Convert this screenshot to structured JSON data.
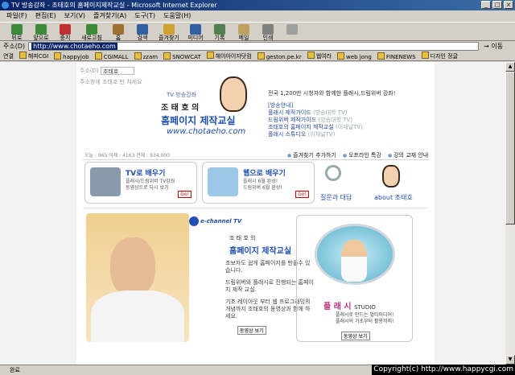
{
  "window": {
    "title": "TV 방송강좌 - 조태호의 홈페이지제작교실 - Microsoft Internet Explorer"
  },
  "menu": [
    "파일(F)",
    "편집(E)",
    "보기(V)",
    "즐겨찾기(A)",
    "도구(T)",
    "도움말(H)"
  ],
  "toolbar": [
    {
      "label": "뒤로",
      "icon": "back-icon",
      "color": "#3a8a3a"
    },
    {
      "label": "앞으로",
      "icon": "forward-icon",
      "color": "#3a8a3a"
    },
    {
      "label": "중지",
      "icon": "stop-icon",
      "color": "#c03030"
    },
    {
      "label": "새로고침",
      "icon": "refresh-icon",
      "color": "#3a8a3a"
    },
    {
      "label": "홈",
      "icon": "home-icon",
      "color": "#a07030"
    },
    {
      "label": "검색",
      "icon": "search-icon",
      "color": "#3060a0"
    },
    {
      "label": "즐겨찾기",
      "icon": "favorites-icon",
      "color": "#d0a030"
    },
    {
      "label": "미디어",
      "icon": "media-icon",
      "color": "#3060a0"
    },
    {
      "label": "기록",
      "icon": "history-icon",
      "color": "#508050"
    },
    {
      "label": "메일",
      "icon": "mail-icon",
      "color": "#c0a060"
    },
    {
      "label": "인쇄",
      "icon": "print-icon",
      "color": "#808080"
    },
    {
      "label": "",
      "icon": "edit-icon",
      "color": "#a0a0a0"
    }
  ],
  "address": {
    "label": "주소(D)",
    "url": "http://www.chotaeho.com",
    "go": "이동"
  },
  "links": {
    "label": "연결",
    "items": [
      "해피CGI",
      "happyjob",
      "CGIMALL",
      "zzam",
      "SNOWCAT",
      "헤이아이자닷컴",
      "geston.pe.kr",
      "웹여라",
      "web jong",
      "FINENEWS",
      "디자인 정글"
    ]
  },
  "site": {
    "login_label": "주소(D)",
    "login_value": "조태호",
    "login_hint": "주소창에 조태호 만 치세요",
    "tv_label": "TV 방송강좌",
    "logo_name": "조 태 호 의",
    "logo_title": "홈페이지 제작교실",
    "logo_url": "www.chotaeho.com",
    "intro": "전국 1,200만 시청자와 함께한 플래시,드림위버 강좌!",
    "news_header": "[방송안내]",
    "news": [
      {
        "text": "플래시 제작가이드",
        "sub": "(방송대학 TV)"
      },
      {
        "text": "드림위버 제작가이드",
        "sub": "(방송대학 TV)"
      },
      {
        "text": "조태호의 홈페이지 제작교실",
        "sub": "(이채널TV)"
      },
      {
        "text": "플래시 스튜디오",
        "sub": "(이채널TV)"
      }
    ],
    "stats": "오늘 : 965   어제 : 4163   전체 : 934,000",
    "toplinks": [
      "즐겨찾기 추가하기",
      "오프라인 특강",
      "강의 교재 안내"
    ],
    "cards": [
      {
        "title": "TV로 배우기",
        "desc1": "플래시/드림위버 TV강좌",
        "desc2": "동영상으로 다시 보기",
        "go": "Go!"
      },
      {
        "title": "웹으로 배우기",
        "desc1": "플래시 6월 완성!",
        "desc2": "드림위버 6월 완성!",
        "go": "Go!"
      }
    ],
    "qa": "질문과 대답",
    "about": "about 조태호",
    "echannel": "e-channel TV",
    "main_logo_name": "조 태 호 의",
    "main_logo_title": "홈페이지 제작교실",
    "main_desc": [
      "초보자도 쉽게 홈페이지를 만들수 있습니다.",
      "드림위버와 플래시로 진행되는 홈페이지 제작 교실.",
      "기초 레이아웃 부터 웹 프로그래밍의 개념까지 조태호의 동영상과 함께 하세요."
    ],
    "main_btn": "동영상 보기",
    "flash_title": "플 래 시",
    "flash_studio": "STUDIO",
    "flash_desc1": "플래시로 만드는 멀티미디어!",
    "flash_desc2": "플래시의 기초부터 활용까지!",
    "flash_btn": "동영상 보기"
  },
  "status": {
    "text": "완료",
    "copyright": "Copyright(c) http://www.happycgi.com"
  }
}
